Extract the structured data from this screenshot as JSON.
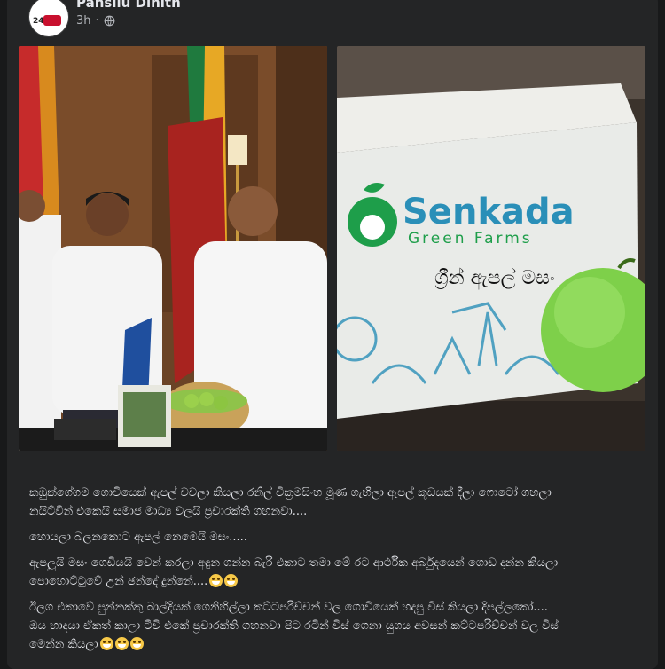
{
  "post": {
    "author": "Pansilu Dinith",
    "time": "3h",
    "avatar_text": "24",
    "images": [
      {
        "name": "meeting-photo"
      },
      {
        "name": "apple-box-photo",
        "brand_line1": "Senkada",
        "brand_line2": "Green Farms",
        "box_text": "ග්‍රීන් ඇපල් මසං"
      }
    ],
    "paragraphs": [
      {
        "lines": [
          "කඹුක්ගේගම ගොවියෙක් ඇපල් වවලා කියලා රනිල් වික්‍රමසිංහ මූණ ගැහිලා ඇපල් කූඩයක් දීලා ෆොටෝ ගහලා",
          "නයිට්වීන් එකෙයි සමාජ මාධ්‍ය වලයි ප්‍රචාරක්ති ගහනවා...."
        ]
      },
      {
        "lines": [
          "හොයලා බලනකොට ඇපල් නෙමෙයි මසං....."
        ]
      },
      {
        "lines": [
          "ඇපලුයි මසං ගෙඩියයි වෙන් කරලා අඳුන ගන්න බැරි එකාට තමා මේ රට ආර්ථික අර්බුදයෙන් ගොඩ දාන්න කියලා",
          "පොහොට්ටුවේ උන් ඡන්දේ දුන්නේ...."
        ],
        "emojis": 2
      },
      {
        "lines": [
          "ඊලග එකාවේ පුන්නක්කු බාල්දියක් ගෙනිහිල්ලා කට්ටපරිච්චන් වල ගොවියෙක් හදපු විස් කියලා දිපල්ලකෝ....",
          "ඔය හාදයා ඒකත් කාලා ටීවි එකේ ප්‍රචාරක්ති ගහනවා පිට රටින් විස් ගෙනා යුගය අවසන් කට්ටපරිච්චන් වල විස්",
          "මෙන්න කියලා"
        ],
        "emojis": 3
      }
    ]
  },
  "colors": {
    "background": "#18191a",
    "card": "#242526",
    "text": "#e4e6eb",
    "secondary_text": "#b0b3b8",
    "brand_green": "#1e9e4a",
    "brand_blue": "#2a8fb8"
  }
}
